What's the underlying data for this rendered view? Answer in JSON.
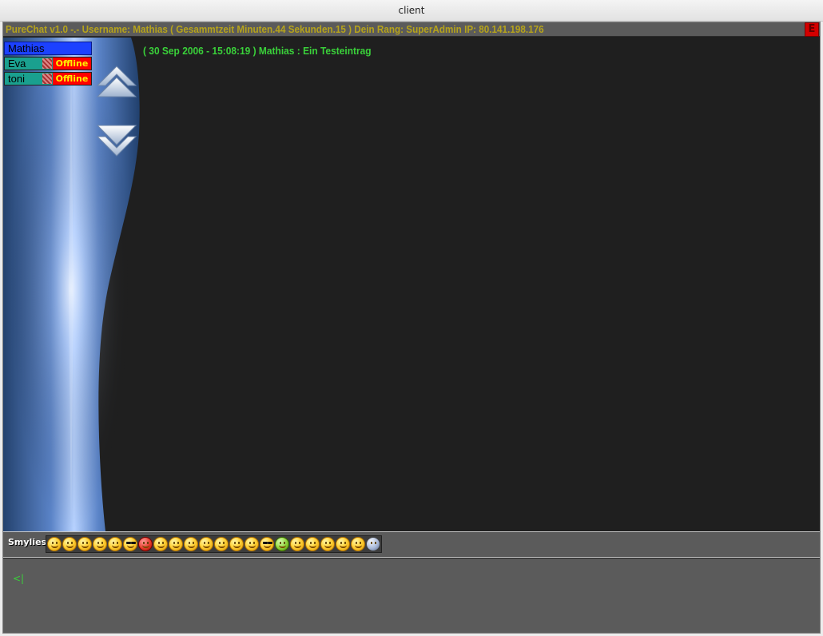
{
  "window": {
    "title": "client"
  },
  "status": {
    "text": "PureChat v1.0 -.- Username: Mathias ( Gesammtzeit  Minuten.44 Sekunden.15 ) Dein Rang: SuperAdmin IP: 80.141.198.176",
    "exit_label": "E"
  },
  "users": [
    {
      "name": "Mathias",
      "status": ""
    },
    {
      "name": "Eva",
      "status": "Offline"
    },
    {
      "name": "toni",
      "status": "Offline"
    }
  ],
  "chat": {
    "messages": [
      {
        "text": "( 30 Sep 2006 - 15:08:19 ) Mathias : Ein Testeintrag"
      }
    ]
  },
  "smileys": {
    "label": "Smylies",
    "icons": [
      "smile-icon",
      "grin-icon",
      "laugh-icon",
      "wink-icon",
      "tongue-icon",
      "cool-icon",
      "angry-icon",
      "happy-icon",
      "sad-icon",
      "cry-icon",
      "surprised-icon",
      "neutral-icon",
      "blush-icon",
      "nerd-icon",
      "glasses-icon",
      "sick-icon",
      "wizard-icon",
      "shy-icon",
      "confused-icon",
      "teeth-icon",
      "worried-icon",
      "globe-icon"
    ]
  },
  "input": {
    "value": "<|"
  },
  "colors": {
    "status_text": "#b6a31b",
    "chat_text": "#3ad13a",
    "offline_badge": "#ff0000",
    "offline_text": "#fff200",
    "active_user": "#1c41ff",
    "away_user": "#1aa08f"
  }
}
